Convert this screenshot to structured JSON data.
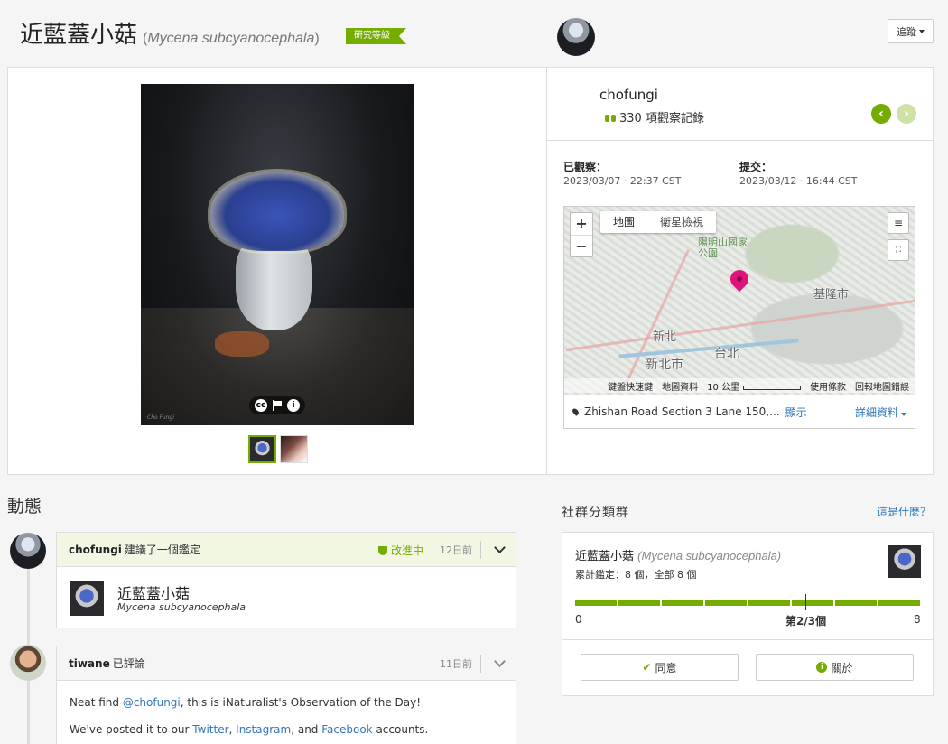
{
  "header": {
    "common_name": "近藍蓋小菇",
    "paren_open": "(",
    "sci_name": "Mycena subcyanocephala",
    "paren_close": ")",
    "grade": "研究等級",
    "follow_label": "追蹤"
  },
  "photo": {
    "credit": "Cho Fungi",
    "license_icon": "cc-icon",
    "thumb_count": 2
  },
  "observer": {
    "name": "chofungi",
    "observations": "330 項觀察記錄"
  },
  "dates": {
    "observed_label": "已觀察：",
    "observed_value": "2023/03/07 · 22:37 CST",
    "submitted_label": "提交：",
    "submitted_value": "2023/03/12 · 16:44 CST"
  },
  "map": {
    "type_map": "地圖",
    "type_satellite": "衛星檢視",
    "labels": {
      "park": "陽明山國家公園",
      "keelung": "基隆市",
      "xinbei_small": "新北",
      "xinbei": "新北市",
      "taipei": "台北"
    },
    "attrib": {
      "shortcuts": "鍵盤快速鍵",
      "data": "地圖資料",
      "scale": "10 公里",
      "terms": "使用條款",
      "report": "回報地圖錯誤"
    },
    "place": "Zhishan Road Section 3 Lane 150,...",
    "show_link": "顯示",
    "details_link": "詳細資料"
  },
  "activity": {
    "heading": "動態",
    "item1": {
      "user": "chofungi",
      "action": "建議了一個鑑定",
      "status": "改進中",
      "time": "12日前",
      "taxon_common": "近藍蓋小菇",
      "taxon_sci": "Mycena subcyanocephala"
    },
    "item2": {
      "user": "tiwane",
      "action": "已評論",
      "time": "11日前",
      "p1_a": "Neat find ",
      "p1_mention": "@chofungi",
      "p1_b": ", this is iNaturalist's Observation of the Day!",
      "p2_a": "We've posted it to our ",
      "p2_twitter": "Twitter",
      "p2_sep1": ", ",
      "p2_instagram": "Instagram",
      "p2_sep2": ", and ",
      "p2_facebook": "Facebook",
      "p2_end": " accounts."
    }
  },
  "community": {
    "heading": "社群分類群",
    "what_link": "這是什麼？",
    "common_name": "近藍蓋小菇",
    "sci_name": "(Mycena subcyanocephala)",
    "summary": "累計鑑定：8 個，全部 8 個",
    "min_label": "0",
    "mid_label": "第2/3個",
    "max_label": "8",
    "agreement": {
      "agree": 8,
      "total": 8,
      "threshold": 0.667
    },
    "agree_button": "同意",
    "about_button": "關於"
  },
  "colors": {
    "accent": "#74ac00",
    "link": "#3176ba",
    "pin": "#e0137a"
  }
}
